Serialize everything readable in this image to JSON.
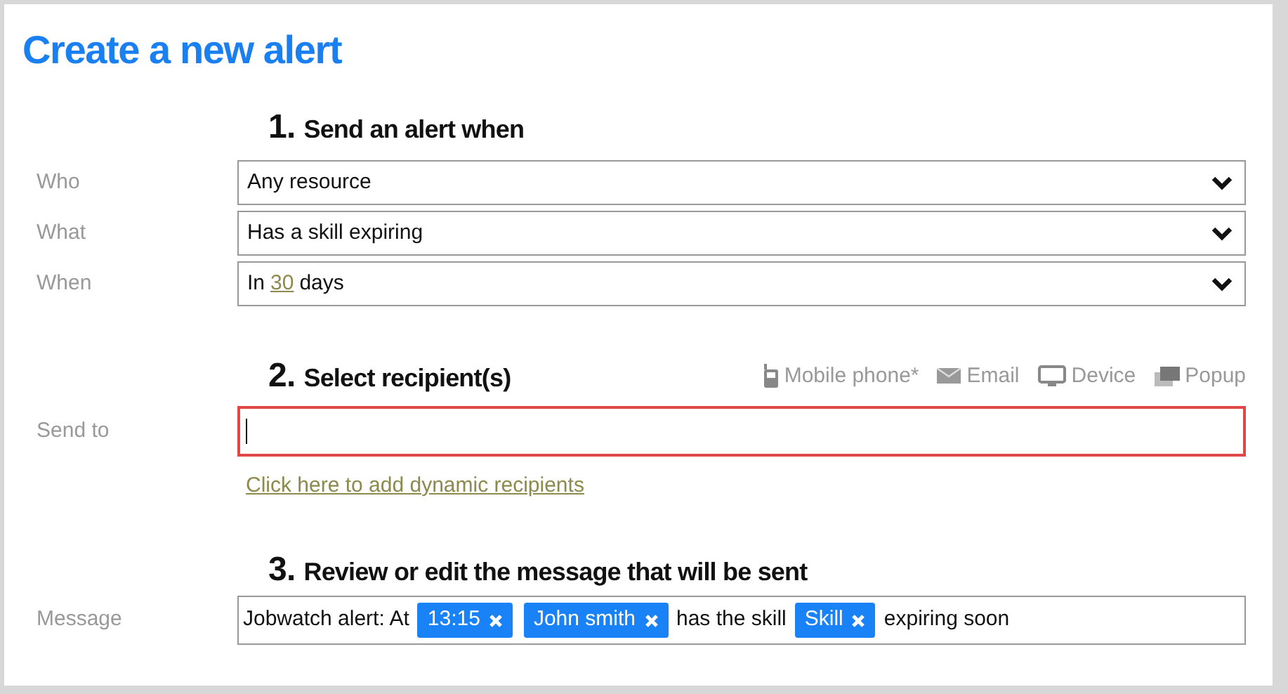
{
  "title": "Create a new alert",
  "step1": {
    "number": "1.",
    "heading": "Send an alert when",
    "rows": [
      {
        "label": "Who",
        "parts": [
          {
            "kind": "text",
            "text": "Any resource"
          }
        ]
      },
      {
        "label": "What",
        "parts": [
          {
            "kind": "text",
            "text": "Has a skill expiring"
          }
        ]
      },
      {
        "label": "When",
        "parts": [
          {
            "kind": "text",
            "text": "In"
          },
          {
            "kind": "link",
            "text": "30"
          },
          {
            "kind": "text",
            "text": "days"
          }
        ]
      }
    ]
  },
  "step2": {
    "number": "2.",
    "heading": "Select recipient(s)",
    "channels": [
      {
        "kind": "phone",
        "label": "Mobile phone*"
      },
      {
        "kind": "email",
        "label": "Email"
      },
      {
        "kind": "device",
        "label": "Device"
      },
      {
        "kind": "popup",
        "label": "Popup"
      }
    ],
    "send_to": {
      "label": "Send to",
      "focused": true
    },
    "link": "Click here to add dynamic recipients"
  },
  "step3": {
    "number": "3.",
    "heading": "Review or edit the message that will be sent",
    "message": {
      "label": "Message",
      "parts": [
        {
          "kind": "text",
          "text": "Jobwatch alert: At"
        },
        {
          "kind": "token",
          "text": "13:15"
        },
        {
          "kind": "token",
          "text": "John smith"
        },
        {
          "kind": "text",
          "text": "has the skill"
        },
        {
          "kind": "token",
          "text": "Skill"
        },
        {
          "kind": "text",
          "text": "expiring soon"
        }
      ]
    }
  }
}
